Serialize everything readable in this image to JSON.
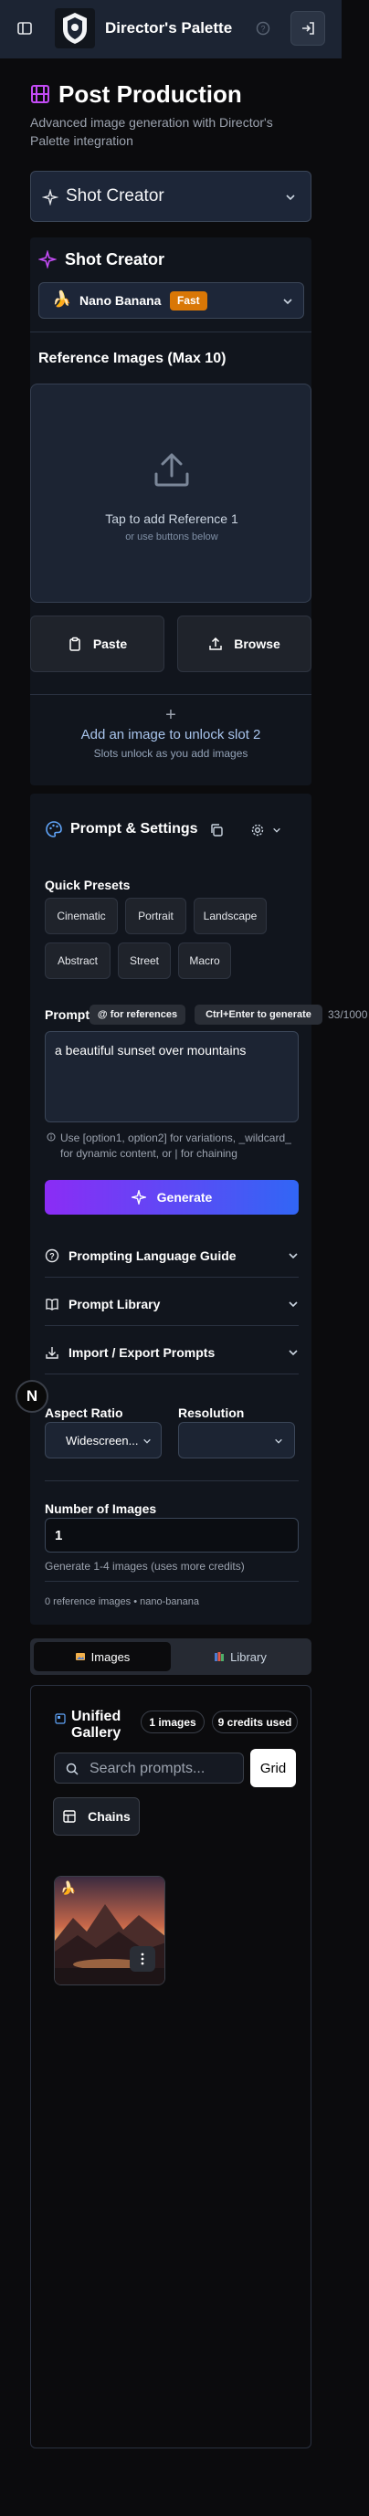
{
  "header": {
    "brand": "Director's Palette",
    "logo_icon": "director-crest-icon"
  },
  "page": {
    "title": "Post Production",
    "subtitle": "Advanced image generation with Director's Palette integration",
    "mode_selector": "Shot Creator"
  },
  "shot_creator": {
    "title": "Shot Creator",
    "model": {
      "emoji": "🍌",
      "name": "Nano Banana",
      "badge": "Fast"
    },
    "reference_title": "Reference Images (Max 10)",
    "dropzone_main": "Tap to add Reference 1",
    "dropzone_sub": "or use buttons below",
    "paste_label": "Paste",
    "browse_label": "Browse",
    "add_plus": "+",
    "add_main": "Add an image to unlock slot 2",
    "add_sub": "Slots unlock as you add images"
  },
  "prompt_settings": {
    "title": "Prompt & Settings",
    "quick_presets_title": "Quick Presets",
    "presets": [
      "Cinematic",
      "Portrait",
      "Landscape",
      "Abstract",
      "Street",
      "Macro"
    ],
    "prompt_label": "Prompt",
    "ref_pill": "@ for references",
    "gen_pill": "Ctrl+Enter to generate",
    "char_count": "33/1000",
    "prompt_value": "a beautiful sunset over mountains",
    "hint": "Use [option1, option2] for variations, _wildcard_ for dynamic content, or | for chaining",
    "generate_label": "Generate",
    "accordions": [
      "Prompting Language Guide",
      "Prompt Library",
      "Import / Export Prompts"
    ],
    "aspect_label": "Aspect Ratio",
    "aspect_value": "Widescreen...",
    "resolution_label": "Resolution",
    "resolution_value": "",
    "num_images_label": "Number of Images",
    "num_images_value": "1",
    "num_images_note": "Generate 1-4 images (uses more credits)",
    "footer_note": "0 reference images • nano-banana"
  },
  "gallery": {
    "tab_images": "Images",
    "tab_library": "Library",
    "title": "Unified Gallery",
    "images_badge": "1 images",
    "credits_badge": "9 credits used",
    "search_placeholder": "Search prompts...",
    "grid_label": "Grid",
    "chains_label": "Chains",
    "thumb_emoji": "🍌"
  },
  "n_badge": "N",
  "colors": {
    "accent_purple": "#8b2cf5",
    "accent_blue": "#3166f5",
    "badge_orange": "#d97706",
    "header_bg": "#1c2433"
  }
}
